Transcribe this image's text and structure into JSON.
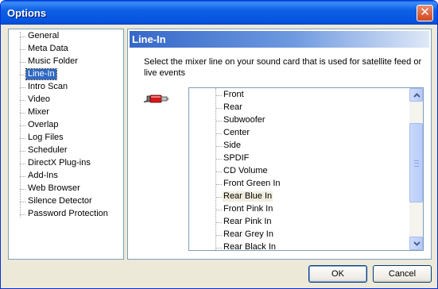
{
  "window": {
    "title": "Options",
    "close_icon": "close-icon"
  },
  "nav": {
    "items": [
      {
        "label": "General"
      },
      {
        "label": "Meta Data"
      },
      {
        "label": "Music Folder"
      },
      {
        "label": "Line-In",
        "selected": true
      },
      {
        "label": "Intro Scan"
      },
      {
        "label": "Video"
      },
      {
        "label": "Mixer"
      },
      {
        "label": "Overlap"
      },
      {
        "label": "Log Files"
      },
      {
        "label": "Scheduler"
      },
      {
        "label": "DirectX Plug-ins"
      },
      {
        "label": "Add-Ins"
      },
      {
        "label": "Web Browser"
      },
      {
        "label": "Silence Detector"
      },
      {
        "label": "Password Protection"
      }
    ]
  },
  "panel": {
    "header": "Line-In",
    "description": "Select the mixer line on your sound card that is used for satellite feed or live events",
    "icon": "audio-plug-icon"
  },
  "mixer_lines": {
    "items": [
      {
        "label": "Front"
      },
      {
        "label": "Rear"
      },
      {
        "label": "Subwoofer"
      },
      {
        "label": "Center"
      },
      {
        "label": "Side"
      },
      {
        "label": "SPDIF"
      },
      {
        "label": "CD Volume"
      },
      {
        "label": "Front Green In"
      },
      {
        "label": "Rear Blue In",
        "selected": true
      },
      {
        "label": "Front Pink In"
      },
      {
        "label": "Rear Pink In"
      },
      {
        "label": "Rear Grey In"
      },
      {
        "label": "Rear Black In"
      }
    ]
  },
  "buttons": {
    "ok": "OK",
    "cancel": "Cancel"
  },
  "colors": {
    "titlebar": "#0554e0",
    "selection": "#316ac5",
    "dialog_bg": "#ece9d8"
  }
}
